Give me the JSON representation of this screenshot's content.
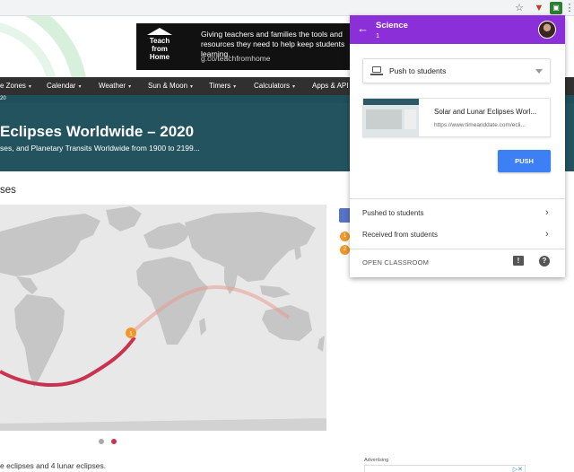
{
  "popup": {
    "title": "Science",
    "subtitle": "1",
    "back_icon": "arrow-back-icon",
    "destination": "Push to students",
    "card": {
      "title": "Solar and Lunar Eclipses Worl...",
      "url": "https://www.timeanddate.com/ecli..."
    },
    "push_label": "PUSH",
    "rows": [
      "Pushed to students",
      "Received from students"
    ],
    "open_classroom": "OPEN CLASSROOM",
    "feedback_icon": "feedback-icon",
    "help_icon": "help-icon",
    "accent": "#8b2fd8",
    "push_color": "#3d7ff5"
  },
  "ad": {
    "logo_text": "Teach from Home",
    "text": "Giving teachers and families the tools and resources they need to help keep students learning.",
    "url": "g.co/teachfromhome"
  },
  "nav": {
    "items": [
      "e Zones",
      "Calendar",
      "Weather",
      "Sun & Moon",
      "Timers",
      "Calculators",
      "Apps & API"
    ]
  },
  "crumb": "20",
  "hero": {
    "title": "Eclipses Worldwide – 2020",
    "subtitle": "ses, and Planetary Transits Worldwide from 1900 to 2199..."
  },
  "section_heading": "ses",
  "map": {
    "marker": "1",
    "side_badges": [
      "1",
      "2"
    ]
  },
  "bottom_text": "e eclipses and 4 lunar eclipses.",
  "advertising_label": "Advertising",
  "colors": {
    "hero_bg": "#22535f",
    "nav_bg": "#303030",
    "eclipse_path": "#c8344f",
    "marker": "#f0962a"
  }
}
